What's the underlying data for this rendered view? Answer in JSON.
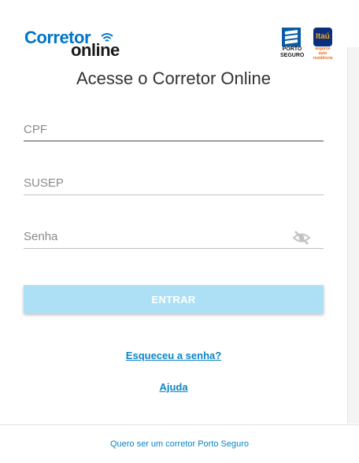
{
  "brand": {
    "logo_line1": "Corretor",
    "logo_line2": "online",
    "porto_label": "PORTO SEGURO",
    "itau_label": "Itaú",
    "itau_sub": "seguros auto residência"
  },
  "login": {
    "title": "Acesse o Corretor Online",
    "cpf_placeholder": "CPF",
    "susep_placeholder": "SUSEP",
    "senha_placeholder": "Senha",
    "submit_label": "ENTRAR"
  },
  "links": {
    "forgot": "Esqueceu a senha?",
    "help": "Ajuda"
  },
  "footer": {
    "become_broker": "Quero ser um corretor Porto Seguro"
  },
  "colors": {
    "brand_blue": "#0074c8",
    "button_bg": "#aee0f5",
    "link": "#0a84c6"
  }
}
